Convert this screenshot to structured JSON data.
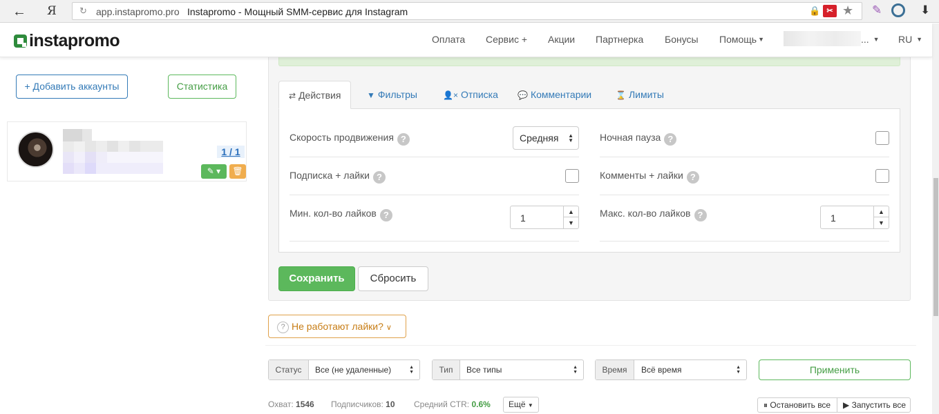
{
  "browser": {
    "back": "←",
    "yandex": "Я",
    "domain": "app.instapromo.pro",
    "title": "Instapromo - Мощный SMM-сервис для Instagram",
    "ext_label": "✂",
    "star": "★",
    "pen": "✎",
    "download": "⬇"
  },
  "header": {
    "logo_text": "instapromo",
    "nav": [
      "Оплата",
      "Сервис +",
      "Акции",
      "Партнерка",
      "Бонусы",
      "Помощь"
    ],
    "user_ellipsis": "...",
    "lang": "RU"
  },
  "sidebar": {
    "add_accounts": "+ Добавить аккаунты",
    "statistics": "Статистика",
    "account": {
      "counter": "1 / 1",
      "edit_icon": "✎ ▾",
      "delete_icon": "🗑"
    }
  },
  "tabs": [
    {
      "icon": "⇄",
      "label": "Действия",
      "active": true
    },
    {
      "icon": "▼",
      "label": "Фильтры",
      "active": false
    },
    {
      "icon": "👤×",
      "label": "Отписка",
      "active": false
    },
    {
      "icon": "💬",
      "label": "Комментарии",
      "active": false
    },
    {
      "icon": "⌛",
      "label": "Лимиты",
      "active": false
    }
  ],
  "settings": {
    "speed_label": "Скорость продвижения",
    "speed_value": "Средняя",
    "night_pause_label": "Ночная пауза",
    "follow_likes_label": "Подписка + лайки",
    "comments_likes_label": "Комменты + лайки",
    "min_likes_label": "Мин. кол-во лайков",
    "min_likes_value": "1",
    "max_likes_label": "Макс. кол-во лайков",
    "max_likes_value": "1",
    "help": "?"
  },
  "actions": {
    "save": "Сохранить",
    "reset": "Сбросить",
    "likes_not_working": "Не работают лайки?"
  },
  "filters": {
    "status_label": "Статус",
    "status_value": "Все (не удаленные)",
    "type_label": "Тип",
    "type_value": "Все типы",
    "time_label": "Время",
    "time_value": "Всё время",
    "apply": "Применить"
  },
  "stats": {
    "reach_label": "Охват:",
    "reach_value": "1546",
    "followers_label": "Подписчиков:",
    "followers_value": "10",
    "ctr_label": "Средний CTR:",
    "ctr_value": "0.6%",
    "more": "Ещё",
    "stop_all": "Остановить все",
    "start_all": "Запустить все"
  },
  "colors": {
    "brand_green": "#5cb85c",
    "link_blue": "#337ab7",
    "warning_orange": "#f0ad4e"
  }
}
